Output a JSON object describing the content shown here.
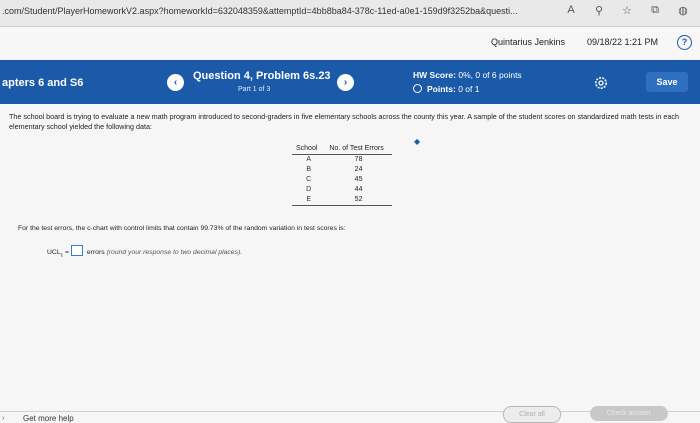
{
  "browser": {
    "url": ".com/Student/PlayerHomeworkV2.aspx?homeworkId=632048359&attemptId=4bb8ba84-378c-11ed-a0e1-159d9f3252ba&questi...",
    "icons": [
      "reader-icon",
      "font-icon",
      "favorite-icon",
      "collections-icon",
      "profile-icon"
    ]
  },
  "user": {
    "name": "Quintarius Jenkins",
    "date": "09/18/22 1:21 PM",
    "help_label": "?"
  },
  "header": {
    "chapter": "apters 6 and S6",
    "question_title": "Question 4, Problem 6s.23",
    "part": "Part 1 of 3",
    "hw_score_label": "HW Score:",
    "hw_score_value": "0%, 0 of 6 points",
    "points_label": "Points:",
    "points_value": "0 of 1",
    "save_label": "Save",
    "prev_glyph": "‹",
    "next_glyph": "›"
  },
  "problem": {
    "text": "The school board is trying to evaluate a new math program introduced to second-graders in five elementary schools across the county this year. A sample of the student scores on standardized math tests in each elementary school yielded the following data:",
    "table": {
      "headers": [
        "School",
        "No. of Test Errors"
      ],
      "rows": [
        {
          "school": "A",
          "errors": "78"
        },
        {
          "school": "B",
          "errors": "24"
        },
        {
          "school": "C",
          "errors": "45"
        },
        {
          "school": "D",
          "errors": "44"
        },
        {
          "school": "E",
          "errors": "52"
        }
      ]
    },
    "tests_text": "For the test errors, the c-chart with control limits that contain 99.73% of the random variation in test scores is:",
    "ucl_label": "UCL",
    "ucl_sub": "c",
    "ucl_eq": "=",
    "ucl_value": "",
    "ucl_hint_prefix": "errors",
    "ucl_hint": "(round your response to two decimal places)."
  },
  "footer": {
    "get_help": "Get more help",
    "clear_all": "Clear all",
    "check_answer": "Check answer"
  }
}
